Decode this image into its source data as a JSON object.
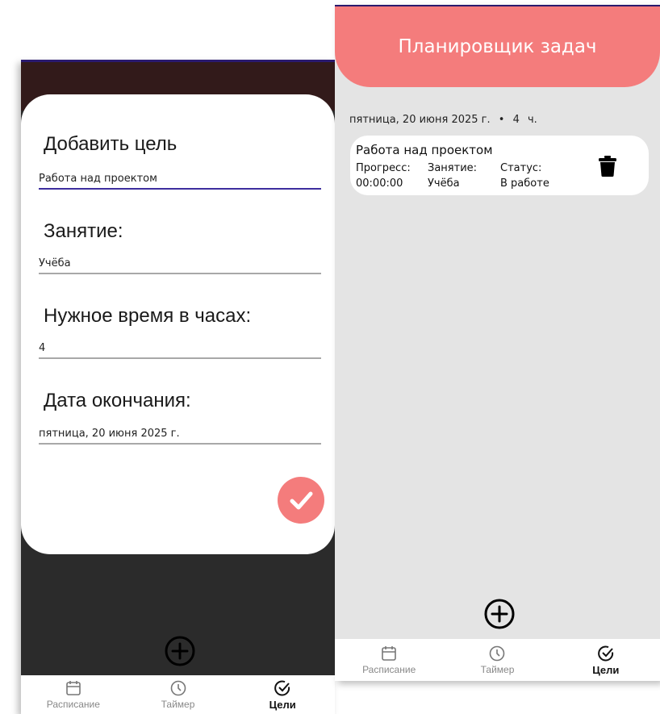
{
  "left_screen": {
    "dialog": {
      "goal_label": "Добавить цель",
      "goal_value": "Работа над проектом",
      "activity_label": "Занятие:",
      "activity_value": "Учёба",
      "hours_label": "Нужное время в часах:",
      "hours_value": "4",
      "end_date_label": "Дата окончания:",
      "end_date_value": "пятница, 20 июня 2025 г."
    },
    "nav": [
      "Расписание",
      "Таймер",
      "Цели"
    ]
  },
  "right_screen": {
    "header_title": "Планировщик задач",
    "date_group": {
      "date": "пятница, 20 июня 2025 г.",
      "bullet": "•",
      "hours": "4",
      "unit": "ч."
    },
    "goal": {
      "title": "Работа над проектом",
      "progress_label": "Прогресс:",
      "progress_value": "00:00:00",
      "activity_label": "Занятие:",
      "activity_value": "Учёба",
      "status_label": "Статус:",
      "status_value": "В работе"
    },
    "nav": [
      "Расписание",
      "Таймер",
      "Цели"
    ]
  },
  "colors": {
    "accent": "#f47c7c",
    "underline_active": "#3d2e9e",
    "overlay": "#2b2b2b",
    "screen_bg": "#e4e4e4"
  },
  "icons": [
    "check-icon",
    "plus-circle-icon",
    "trash-icon",
    "calendar-icon",
    "clock-icon",
    "check-circle-icon"
  ]
}
